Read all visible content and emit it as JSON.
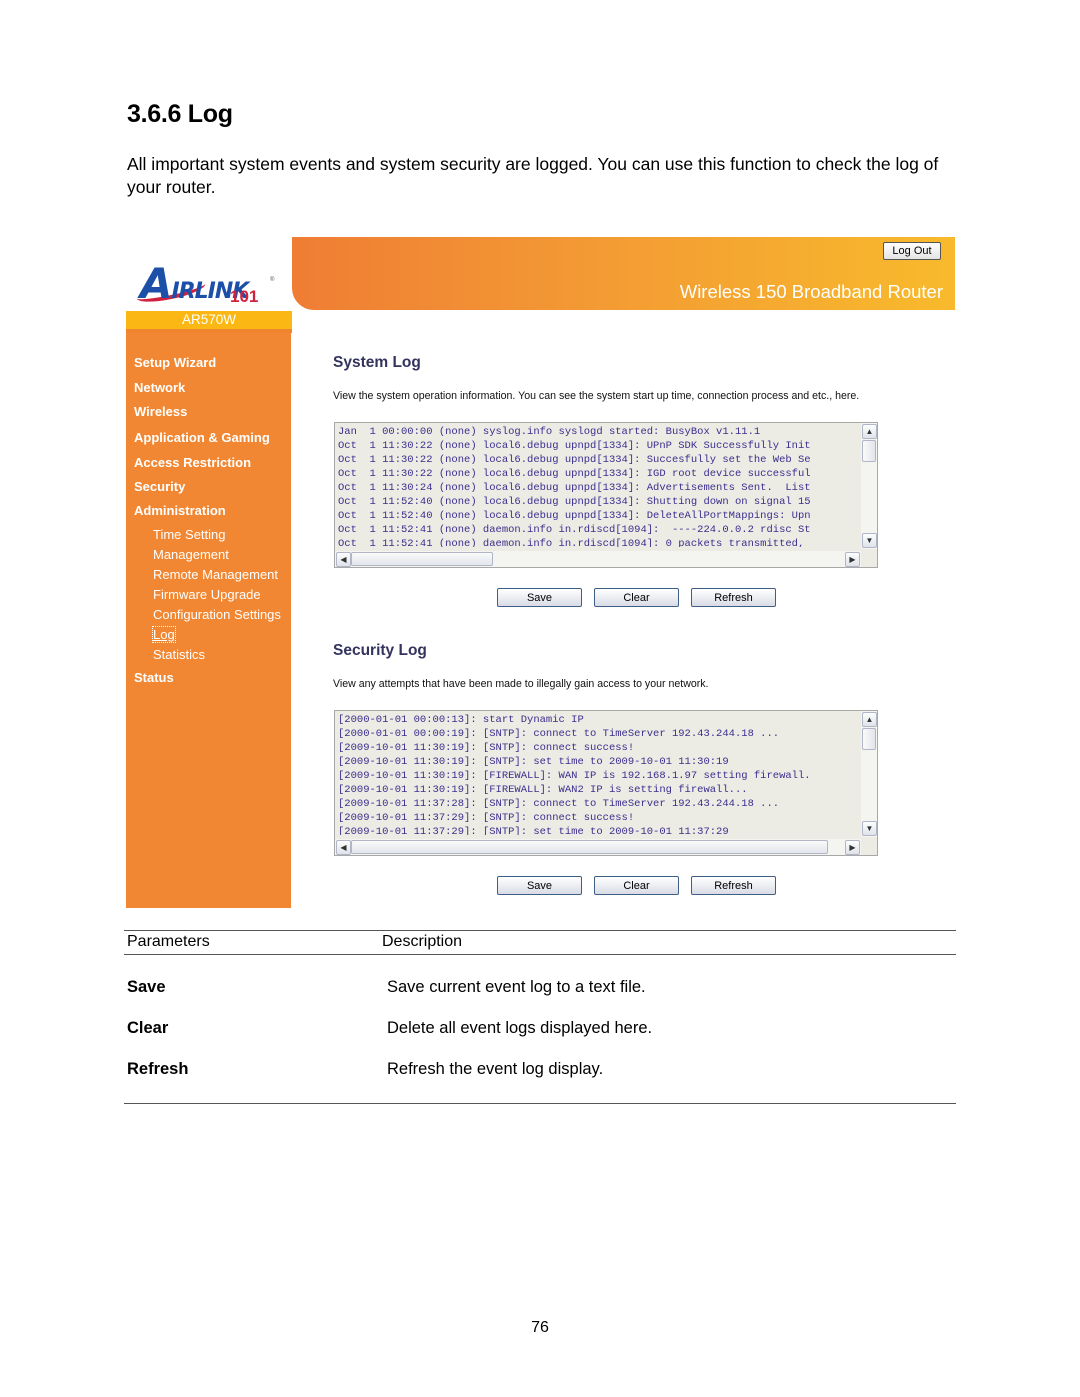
{
  "document": {
    "heading": "3.6.6 Log",
    "intro": "All important system events and system security are logged. You can use this function to check the log of your router.",
    "page_number": "76"
  },
  "router_ui": {
    "brand": {
      "logo_letter": "A",
      "logo_text": "IRLINK",
      "logo_number": "101",
      "registered_mark": "®",
      "model": "AR570W"
    },
    "header": {
      "logout_label": "Log Out",
      "title": "Wireless 150 Broadband Router"
    },
    "colors": {
      "sidebar": "#f18732",
      "model_bar": "#fbb814",
      "section_title": "#33335e",
      "log_text": "#3b2f8e",
      "log_background": "#ecebe4"
    },
    "sidebar": {
      "items": [
        {
          "label": "Setup Wizard"
        },
        {
          "label": "Network"
        },
        {
          "label": "Wireless"
        },
        {
          "label": "Application & Gaming"
        },
        {
          "label": "Access Restriction"
        },
        {
          "label": "Security"
        },
        {
          "label": "Administration"
        }
      ],
      "admin_subitems": [
        {
          "label": "Time Setting"
        },
        {
          "label": "Management"
        },
        {
          "label": "Remote Management"
        },
        {
          "label": "Firmware Upgrade"
        },
        {
          "label": "Configuration Settings"
        },
        {
          "label": "Log",
          "active": true
        },
        {
          "label": "Statistics"
        }
      ],
      "status_label": "Status"
    },
    "system_log": {
      "title": "System Log",
      "description": "View the system operation information. You can see the system start up time, connection process and etc., here.",
      "lines": [
        "Jan  1 00:00:00 (none) syslog.info syslogd started: BusyBox v1.11.1",
        "Oct  1 11:30:22 (none) local6.debug upnpd[1334]: UPnP SDK Successfully Init",
        "Oct  1 11:30:22 (none) local6.debug upnpd[1334]: Succesfully set the Web Se",
        "Oct  1 11:30:22 (none) local6.debug upnpd[1334]: IGD root device successful",
        "Oct  1 11:30:24 (none) local6.debug upnpd[1334]: Advertisements Sent.  List",
        "Oct  1 11:52:40 (none) local6.debug upnpd[1334]: Shutting down on signal 15",
        "Oct  1 11:52:40 (none) local6.debug upnpd[1334]: DeleteAllPortMappings: Upn",
        "Oct  1 11:52:41 (none) daemon.info in.rdiscd[1094]:  ----224.0.0.2 rdisc St",
        "Oct  1 11:52:41 (none) daemon.info in.rdiscd[1094]: 0 packets transmitted,"
      ],
      "buttons": {
        "save": "Save",
        "clear": "Clear",
        "refresh": "Refresh"
      }
    },
    "security_log": {
      "title": "Security Log",
      "description": "View any attempts that have been made to illegally gain access to your network.",
      "lines": [
        "[2000-01-01 00:00:13]: start Dynamic IP",
        "[2000-01-01 00:00:19]: [SNTP]: connect to TimeServer 192.43.244.18 ...",
        "[2009-10-01 11:30:19]: [SNTP]: connect success!",
        "[2009-10-01 11:30:19]: [SNTP]: set time to 2009-10-01 11:30:19",
        "[2009-10-01 11:30:19]: [FIREWALL]: WAN IP is 192.168.1.97 setting firewall.",
        "[2009-10-01 11:30:19]: [FIREWALL]: WAN2 IP is setting firewall...",
        "[2009-10-01 11:37:28]: [SNTP]: connect to TimeServer 192.43.244.18 ...",
        "[2009-10-01 11:37:29]: [SNTP]: connect success!",
        "[2009-10-01 11:37:29]: [SNTP]: set time to 2009-10-01 11:37:29"
      ],
      "buttons": {
        "save": "Save",
        "clear": "Clear",
        "refresh": "Refresh"
      }
    },
    "scroll_glyphs": {
      "up": "▲",
      "down": "▼",
      "left": "◀",
      "right": "▶"
    }
  },
  "parameters_table": {
    "headers": [
      "Parameters",
      "Description"
    ],
    "rows": [
      {
        "name": "Save",
        "description": "Save current event log to a text file."
      },
      {
        "name": "Clear",
        "description": "Delete all event logs displayed here."
      },
      {
        "name": "Refresh",
        "description": "Refresh the event log display."
      }
    ]
  }
}
